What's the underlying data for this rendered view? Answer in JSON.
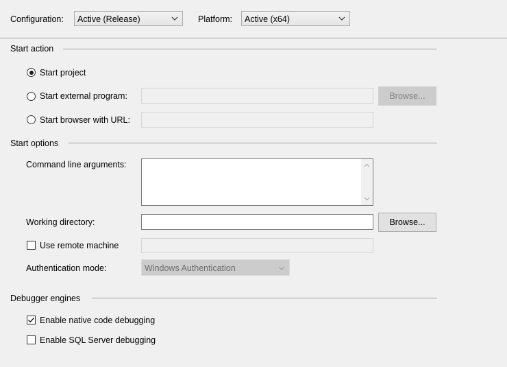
{
  "header": {
    "configuration_label": "Configuration:",
    "configuration_value": "Active (Release)",
    "platform_label": "Platform:",
    "platform_value": "Active (x64)"
  },
  "start_action": {
    "title": "Start action",
    "start_project": "Start project",
    "start_external_program": "Start external program:",
    "external_browse": "Browse...",
    "start_browser_url": "Start browser with URL:",
    "selected": "start_project"
  },
  "start_options": {
    "title": "Start options",
    "command_line_label": "Command line arguments:",
    "command_line_value": "",
    "working_directory_label": "Working directory:",
    "working_directory_value": "",
    "working_browse": "Browse...",
    "use_remote_machine": "Use remote machine",
    "use_remote_checked": false,
    "auth_mode_label": "Authentication mode:",
    "auth_mode_value": "Windows Authentication"
  },
  "debugger_engines": {
    "title": "Debugger engines",
    "native_code": "Enable native code debugging",
    "native_checked": true,
    "sql_server": "Enable SQL Server debugging",
    "sql_checked": false
  },
  "icons": [
    "chevron-down-icon",
    "checkmark-icon",
    "scroll-up-icon",
    "scroll-down-icon"
  ],
  "colors": {
    "background": "#f0f0f0",
    "border": "#a0a0a0",
    "disabled_text": "#838383"
  }
}
